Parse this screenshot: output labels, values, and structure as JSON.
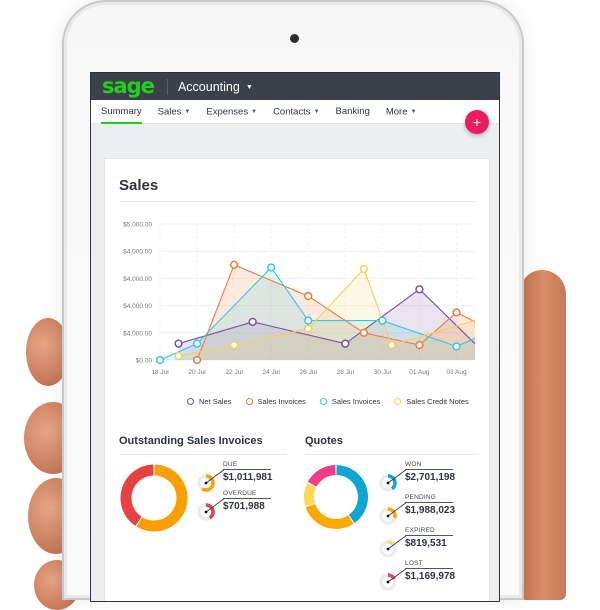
{
  "app": {
    "logo": "sage",
    "title": "Accounting"
  },
  "nav": {
    "items": [
      {
        "label": "Summary",
        "active": true,
        "dropdown": false
      },
      {
        "label": "Sales",
        "active": false,
        "dropdown": true
      },
      {
        "label": "Expenses",
        "active": false,
        "dropdown": true
      },
      {
        "label": "Contacts",
        "active": false,
        "dropdown": true
      },
      {
        "label": "Banking",
        "active": false,
        "dropdown": false
      },
      {
        "label": "More",
        "active": false,
        "dropdown": true
      }
    ],
    "fab_icon": "+"
  },
  "colors": {
    "brand_green": "#1fd31a",
    "topbar": "#3c4049",
    "fab": "#ea1d63"
  },
  "sales": {
    "title": "Sales"
  },
  "chart_data": {
    "type": "area",
    "title": "Sales",
    "xlabel": "",
    "ylabel": "",
    "x_ticks": [
      "18 Jul",
      "20 Jul",
      "22 Jul",
      "24 Jul",
      "26 Jul",
      "28 Jul",
      "30 Jul",
      "01 Aug",
      "03 Aug"
    ],
    "y_ticks": [
      "$0.00",
      "$4,000.00",
      "$4,000.00",
      "$4,000.00",
      "$4,000.00",
      "$5,000.00"
    ],
    "ylim": [
      0,
      5000
    ],
    "xlim_days": [
      0,
      17
    ],
    "grid": true,
    "legend_position": "bottom",
    "series": [
      {
        "name": "Net Sales",
        "color": "#7b4fa3",
        "points": [
          [
            1,
            600
          ],
          [
            5,
            1400
          ],
          [
            10,
            600
          ],
          [
            14,
            2600
          ],
          [
            17,
            600
          ]
        ]
      },
      {
        "name": "Sales  Invoices",
        "color": "#f07a3a",
        "points": [
          [
            2,
            0
          ],
          [
            4,
            3500
          ],
          [
            8,
            2350
          ],
          [
            11,
            1000
          ],
          [
            14,
            550
          ],
          [
            16,
            1750
          ],
          [
            17,
            1400
          ]
        ]
      },
      {
        "name": "Sales Invoices",
        "color": "#37c5e8",
        "points": [
          [
            0,
            0
          ],
          [
            2,
            600
          ],
          [
            6,
            3400
          ],
          [
            8,
            1450
          ],
          [
            12,
            1450
          ],
          [
            16,
            500
          ],
          [
            17,
            800
          ]
        ]
      },
      {
        "name": "Sales Credit Notes",
        "color": "#f5cf5f",
        "points": [
          [
            1,
            150
          ],
          [
            4,
            550
          ],
          [
            8,
            1150
          ],
          [
            11,
            3350
          ],
          [
            12.5,
            550
          ],
          [
            17,
            1450
          ]
        ]
      }
    ]
  },
  "outstanding": {
    "title": "Outstanding Sales Invoices",
    "donut": [
      {
        "name": "Due",
        "value": 1011981,
        "color": "#fa9f00"
      },
      {
        "name": "Overdue",
        "value": 701988,
        "color": "#e84141"
      }
    ],
    "stats": [
      {
        "label": "DUE",
        "value": "$1,011,981",
        "color": "#fa9f00",
        "fraction": 0.59
      },
      {
        "label": "OVERDUE",
        "value": "$701,988",
        "color": "#e84141",
        "fraction": 0.41
      }
    ]
  },
  "quotes": {
    "title": "Quotes",
    "donut": [
      {
        "name": "Won",
        "value": 2701198,
        "color": "#0ea5d0"
      },
      {
        "name": "Pending",
        "value": 1988023,
        "color": "#fba800"
      },
      {
        "name": "Expired",
        "value": 819531,
        "color": "#fdd955"
      },
      {
        "name": "Lost",
        "value": 1169978,
        "color": "#ef3d86"
      }
    ],
    "stats": [
      {
        "label": "WON",
        "value": "$2,701,198",
        "color": "#0ea5d0",
        "fraction": 0.4
      },
      {
        "label": "PENDING",
        "value": "$1,988,023",
        "color": "#fba800",
        "fraction": 0.3
      },
      {
        "label": "EXPIRED",
        "value": "$819,531",
        "color": "#fdd955",
        "fraction": 0.12
      },
      {
        "label": "LOST",
        "value": "$1,169,978",
        "color": "#ef3d86",
        "fraction": 0.18
      }
    ]
  }
}
